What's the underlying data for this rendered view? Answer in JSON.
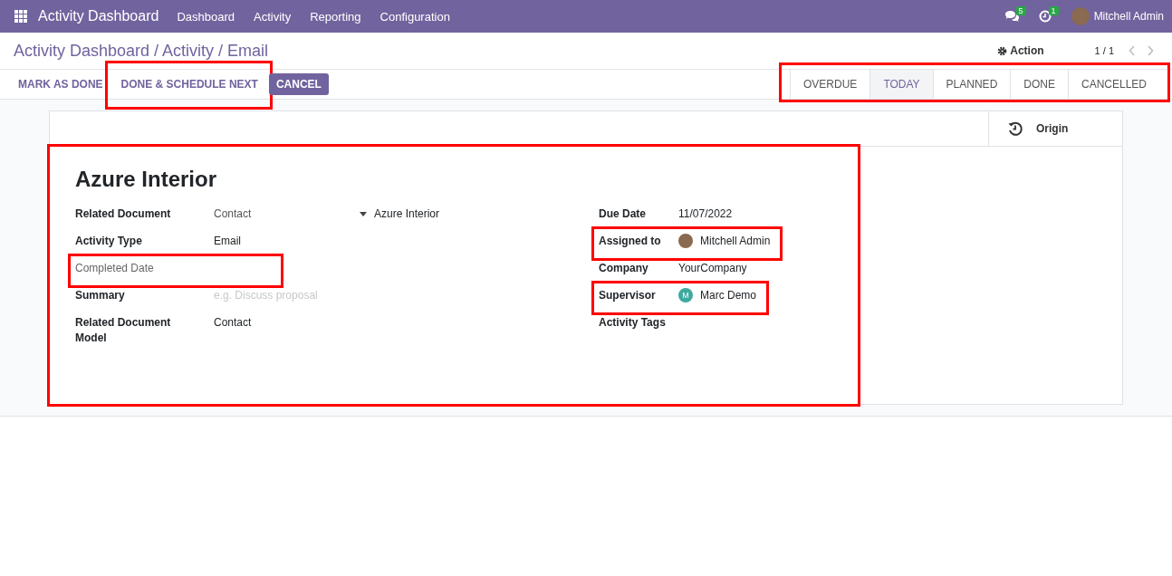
{
  "navbar": {
    "app_name": "Activity Dashboard",
    "menu": [
      "Dashboard",
      "Activity",
      "Reporting",
      "Configuration"
    ],
    "messages_count": "5",
    "activities_count": "1",
    "user": "Mitchell Admin"
  },
  "breadcrumb": "Activity Dashboard / Activity / Email",
  "action_menu": "Action",
  "pager": "1 / 1",
  "buttons": [
    {
      "label": "MARK AS DONE",
      "kind": "link",
      "highlighted": false
    },
    {
      "label": "DONE & SCHEDULE NEXT",
      "kind": "link",
      "highlighted": true
    },
    {
      "label": "CANCEL",
      "kind": "primary",
      "highlighted": false
    }
  ],
  "status_bar": {
    "highlighted": true,
    "stages": [
      {
        "label": "OVERDUE",
        "selected": false
      },
      {
        "label": "TODAY",
        "selected": true
      },
      {
        "label": "PLANNED",
        "selected": false
      },
      {
        "label": "DONE",
        "selected": false
      },
      {
        "label": "CANCELLED",
        "selected": false
      }
    ]
  },
  "smart_button": "Origin",
  "form": {
    "highlighted": true,
    "title": "Azure Interior",
    "left_fields": [
      {
        "label": "Related Document",
        "value": "Contact",
        "kind": "reference",
        "reference": "Azure Interior",
        "highlighted": false
      },
      {
        "label": "Activity Type",
        "value": "Email",
        "kind": "text",
        "highlighted": false
      },
      {
        "label": "Completed Date",
        "kind": "muted",
        "highlighted": true
      },
      {
        "label": "Summary",
        "placeholder": "e.g. Discuss proposal",
        "kind": "input",
        "highlighted": false
      },
      {
        "label": "Related Document Model",
        "value": "Contact",
        "kind": "text",
        "highlighted": false
      }
    ],
    "right_fields": [
      {
        "label": "Due Date",
        "value": "11/07/2022",
        "kind": "text",
        "highlighted": false
      },
      {
        "label": "Assigned to",
        "value": "Mitchell Admin",
        "kind": "user",
        "highlighted": true
      },
      {
        "label": "Company",
        "value": "YourCompany",
        "kind": "text",
        "highlighted": false
      },
      {
        "label": "Supervisor",
        "value": "Marc Demo",
        "kind": "initial",
        "initial": "M",
        "highlighted": true
      },
      {
        "label": "Activity Tags",
        "kind": "text",
        "highlighted": false
      }
    ]
  }
}
